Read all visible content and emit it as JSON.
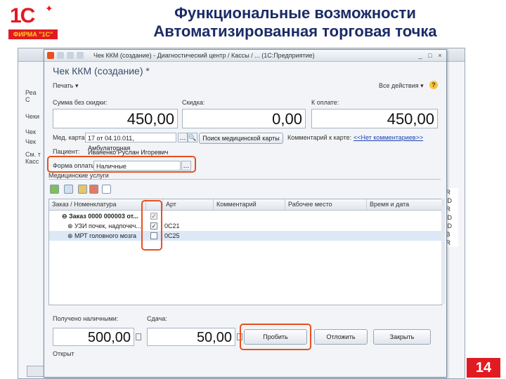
{
  "slide": {
    "logo_text": "1С",
    "logo_firm": "ФИРМА \"1С\"",
    "title_line1": "Функциональные возможности",
    "title_line2": "Автоматизированная торговая точка",
    "page_number": "14"
  },
  "background_window": {
    "side_labels": [
      "Реа",
      "С",
      "Чеки",
      "Чек",
      "Чек",
      "См. т",
      "Касс"
    ],
    "right_letters": [
      "IR",
      "JD",
      "IR",
      "JD",
      "JD",
      "IB",
      "IR"
    ]
  },
  "dialog": {
    "window_title": "Чек ККМ (создание) - Диагностический центр / Кассы / ... (1С:Предприятие)",
    "doc_title": "Чек ККМ (создание) *",
    "print_label": "Печать ▾",
    "all_actions_label": "Все действия ▾",
    "help_label": "?",
    "sum_no_discount_label": "Сумма без скидки:",
    "sum_no_discount_value": "450,00",
    "discount_label": "Скидка:",
    "discount_value": "0,00",
    "to_pay_label": "К оплате:",
    "to_pay_value": "450,00",
    "med_card_label": "Мед. карта:",
    "med_card_value": "17 от 04.10.011, Амбулаторная",
    "search_card_button": "Поиск медицинской карты",
    "card_comment_label": "Комментарий к карте:",
    "card_comment_link": "<<Нет комментариев>>",
    "patient_label": "Пациент:",
    "patient_value": "Иваненко Руслан Игоревич",
    "payment_form_label": "Форма оплаты:",
    "payment_form_value": "Наличные",
    "services_header": "Медицинские услуги",
    "grid_columns": [
      "Заказ / Номенклатура",
      "",
      "Арт",
      "Комментарий",
      "Рабочее место",
      "Время и дата"
    ],
    "grid_rows": [
      {
        "name": "⊖ Заказ 0000 000003 от...",
        "checked": "✓",
        "art": "",
        "bold": true,
        "muted": true
      },
      {
        "name": "⊕ УЗИ почек, надпочеч...",
        "checked": "✓",
        "art": "0C21",
        "bold": false,
        "muted": false
      },
      {
        "name": "⊕ МРТ головного мозга",
        "checked": "",
        "art": "0C25",
        "bold": false,
        "muted": false
      }
    ],
    "received_label": "Получено наличными:",
    "received_value": "500,00",
    "change_label": "Сдача:",
    "change_value": "50,00",
    "punch_button": "Пробить",
    "defer_button": "Отложить",
    "close_button": "Закрыть",
    "status_text": "Открыт"
  },
  "colors": {
    "brand_red": "#e11b22",
    "title_blue": "#1a2b66",
    "highlight_orange": "#e8501e",
    "link_blue": "#1d43b8"
  }
}
